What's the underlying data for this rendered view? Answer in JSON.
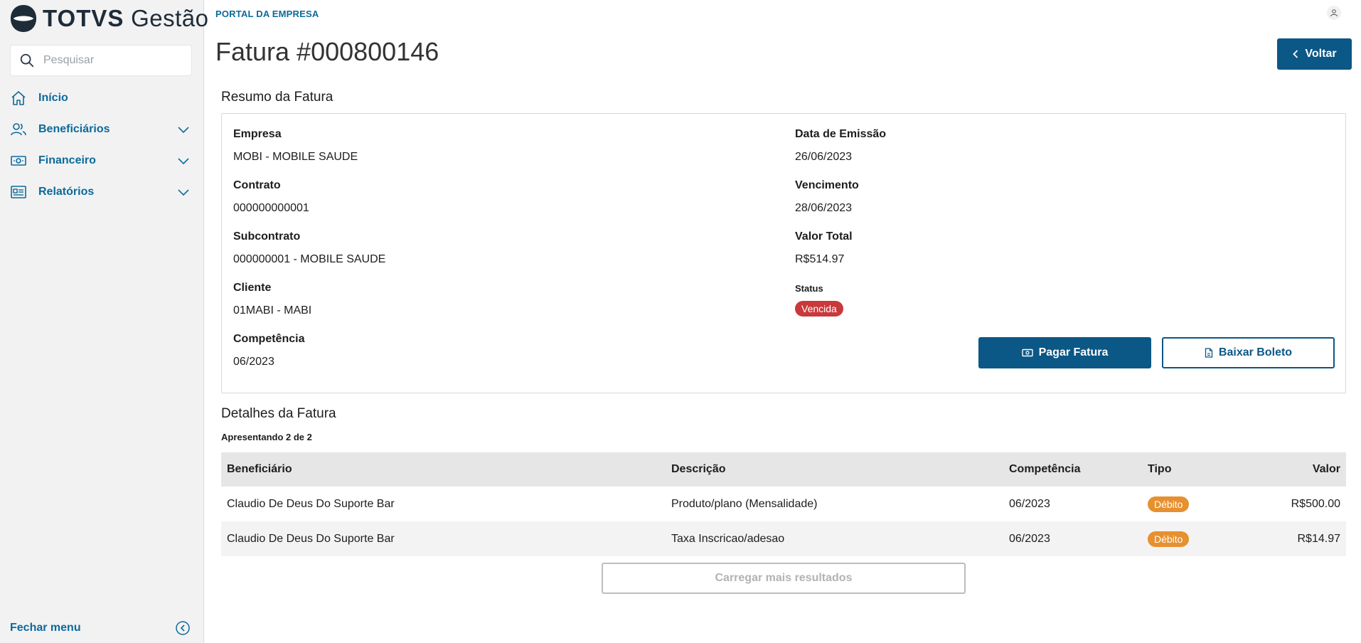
{
  "sidebar": {
    "logo": {
      "brand_bold": "TOTVS",
      "brand_light": "Gestão"
    },
    "search": {
      "placeholder": "Pesquisar",
      "value": ""
    },
    "items": [
      {
        "label": "Início",
        "icon": "home-icon",
        "expandable": false
      },
      {
        "label": "Beneficiários",
        "icon": "people-icon",
        "expandable": true
      },
      {
        "label": "Financeiro",
        "icon": "money-icon",
        "expandable": true
      },
      {
        "label": "Relatórios",
        "icon": "report-icon",
        "expandable": true
      }
    ],
    "close_menu_label": "Fechar menu"
  },
  "header": {
    "portal_label": "PORTAL DA EMPRESA",
    "user_icon": "user-icon"
  },
  "page": {
    "title": "Fatura #000800146",
    "back_button": "Voltar"
  },
  "summary": {
    "title": "Resumo da Fatura",
    "left": [
      {
        "label": "Empresa",
        "value": "MOBI - MOBILE SAUDE"
      },
      {
        "label": "Contrato",
        "value": "000000000001"
      },
      {
        "label": "Subcontrato",
        "value": "000000001 - MOBILE SAUDE"
      },
      {
        "label": "Cliente",
        "value": "01MABI - MABI"
      },
      {
        "label": "Competência",
        "value": "06/2023"
      }
    ],
    "right": [
      {
        "label": "Data de Emissão",
        "value": "26/06/2023"
      },
      {
        "label": "Vencimento",
        "value": "28/06/2023"
      },
      {
        "label": "Valor Total",
        "value": "R$514.97"
      }
    ],
    "status": {
      "label": "Status",
      "value": "Vencida",
      "color": "#c9393b"
    },
    "pay_button": "Pagar Fatura",
    "download_button": "Baixar Boleto"
  },
  "details": {
    "title": "Detalhes da Fatura",
    "showing": "Apresentando 2 de 2",
    "columns": [
      "Beneficiário",
      "Descrição",
      "Competência",
      "Tipo",
      "Valor"
    ],
    "rows": [
      {
        "beneficiario": "Claudio De Deus Do Suporte Bar",
        "descricao": "Produto/plano (Mensalidade)",
        "competencia": "06/2023",
        "tipo": "Débito",
        "valor": "R$500.00"
      },
      {
        "beneficiario": "Claudio De Deus Do Suporte Bar",
        "descricao": "Taxa Inscricao/adesao",
        "competencia": "06/2023",
        "tipo": "Débito",
        "valor": "R$14.97"
      }
    ],
    "load_more": "Carregar mais resultados"
  },
  "colors": {
    "primary": "#0b5786",
    "nav_text": "#0c6a9b",
    "status_overdue": "#c9393b",
    "debit_badge": "#e7902f"
  }
}
